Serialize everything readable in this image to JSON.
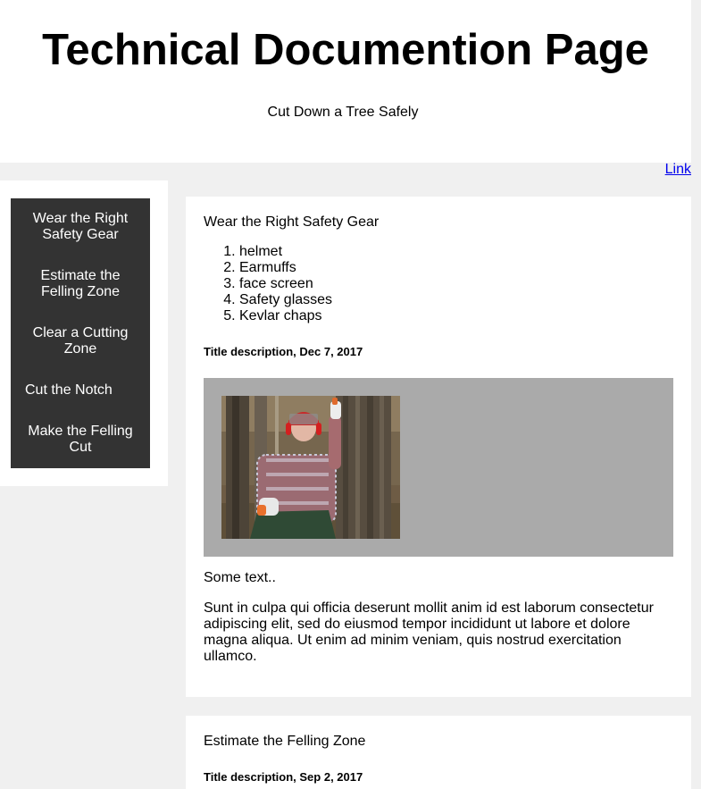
{
  "header": {
    "title": "Technical Documention Page",
    "subtitle": "Cut Down a Tree Safely"
  },
  "top_link": "Link",
  "nav": {
    "items": [
      "Wear the Right Safety Gear",
      "Estimate the Felling Zone",
      "Clear a Cutting Zone",
      "Cut the Notch",
      "Make the Felling Cut"
    ]
  },
  "sections": [
    {
      "heading": "Wear the Right Safety Gear",
      "list": [
        "helmet",
        "Earmuffs",
        "face screen",
        "Safety glasses",
        "Kevlar chaps"
      ],
      "date": "Title description, Dec 7, 2017",
      "image_icon": "lumberjack-photo",
      "short_text": "Some text..",
      "paragraph": "Sunt in culpa qui officia deserunt mollit anim id est laborum consectetur adipiscing elit, sed do eiusmod tempor incididunt ut labore et dolore magna aliqua. Ut enim ad minim veniam, quis nostrud exercitation ullamco."
    },
    {
      "heading": "Estimate the Felling Zone",
      "date": "Title description, Sep 2, 2017"
    }
  ]
}
